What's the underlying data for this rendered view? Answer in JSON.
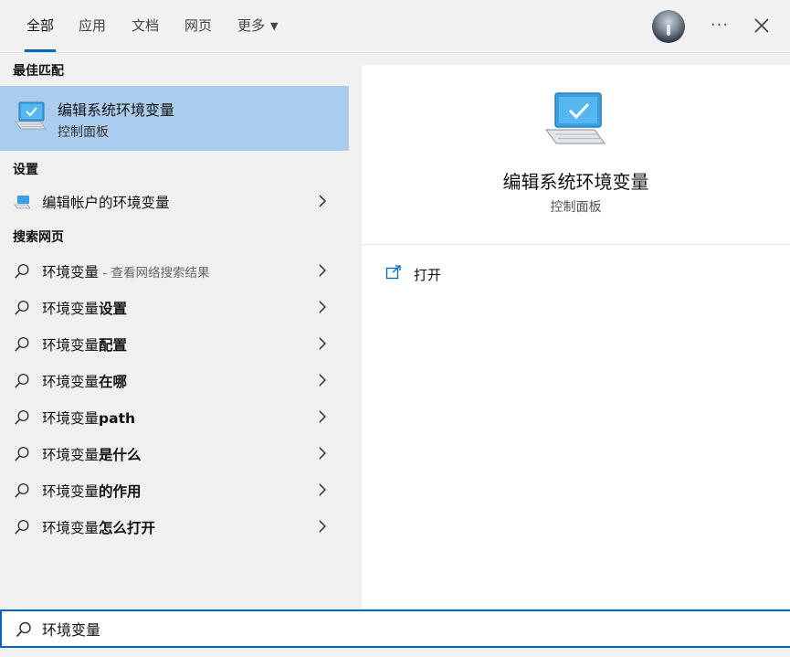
{
  "tabs": [
    {
      "label": "全部"
    },
    {
      "label": "应用"
    },
    {
      "label": "文档"
    },
    {
      "label": "网页"
    },
    {
      "label": "更多"
    }
  ],
  "more_menu_glyph": "···",
  "sections": {
    "best_match": "最佳匹配",
    "settings": "设置",
    "web_search": "搜索网页"
  },
  "best_match": {
    "title": "编辑系统环境变量",
    "subtitle": "控制面板",
    "icon": "computer-monitor-icon"
  },
  "settings_items": [
    {
      "label": "编辑帐户的环境变量",
      "icon": "settings-monitor-icon"
    }
  ],
  "web_items": [
    {
      "prefix": "环境变量",
      "suffix": "",
      "hint": " - 查看网络搜索结果"
    },
    {
      "prefix": "环境变量",
      "suffix": "设置",
      "hint": ""
    },
    {
      "prefix": "环境变量",
      "suffix": "配置",
      "hint": ""
    },
    {
      "prefix": "环境变量",
      "suffix": "在哪",
      "hint": ""
    },
    {
      "prefix": "环境变量",
      "suffix": "path",
      "hint": ""
    },
    {
      "prefix": "环境变量",
      "suffix": "是什么",
      "hint": ""
    },
    {
      "prefix": "环境变量",
      "suffix": "的作用",
      "hint": ""
    },
    {
      "prefix": "环境变量",
      "suffix": "怎么打开",
      "hint": ""
    }
  ],
  "preview": {
    "title": "编辑系统环境变量",
    "subtitle": "控制面板",
    "actions": [
      {
        "label": "打开",
        "icon": "open-external-icon"
      }
    ]
  },
  "search": {
    "value": "环境变量"
  },
  "colors": {
    "accent": "#0067c0",
    "selected_bg": "#aacdee",
    "panel_bg": "#f0f0f0",
    "preview_bg": "#ffffff"
  }
}
